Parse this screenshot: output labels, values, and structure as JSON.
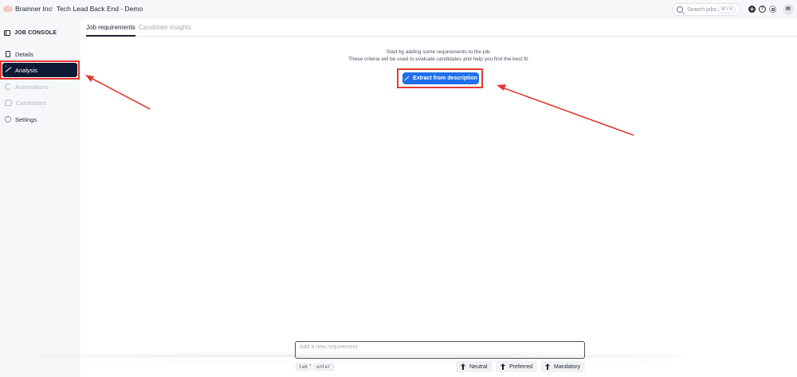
{
  "topbar": {
    "org": "Brainner Inc",
    "separator": "/",
    "job_title": "Tech Lead Back End - Demo",
    "search_placeholder": "Search jobs...",
    "search_shortcut": "⌘ + K",
    "help_glyph": "?",
    "avatar_initials": "IR"
  },
  "sidebar": {
    "title": "JOB CONSOLE",
    "items": [
      {
        "label": "Details",
        "icon": "document-icon",
        "state": "normal"
      },
      {
        "label": "Analysis",
        "icon": "chart-wand-icon",
        "state": "active"
      },
      {
        "label": "Automations",
        "icon": "refresh-icon",
        "state": "disabled"
      },
      {
        "label": "Candidates",
        "icon": "users-icon",
        "state": "disabled"
      },
      {
        "label": "Settings",
        "icon": "gear-icon",
        "state": "normal"
      }
    ]
  },
  "main": {
    "tabs": [
      {
        "label": "Job requirements",
        "active": true
      },
      {
        "label": "Candidate insights",
        "active": false
      }
    ],
    "empty_line1": "Start by adding some requirements to the job.",
    "empty_line2": "These criteria will be used to evaluate candidates and help you find the best fit.",
    "extract_button": "Extract from description"
  },
  "composer": {
    "placeholder": "Add a new requirement",
    "key_tab": "tab",
    "key_plus": "+",
    "key_enter": "enter",
    "priorities": [
      "Neutral",
      "Preferred",
      "Mandatory"
    ]
  },
  "colors": {
    "accent": "#1f6feb",
    "active_nav_bg": "#0e1a36",
    "annotation": "#e23b2e"
  }
}
